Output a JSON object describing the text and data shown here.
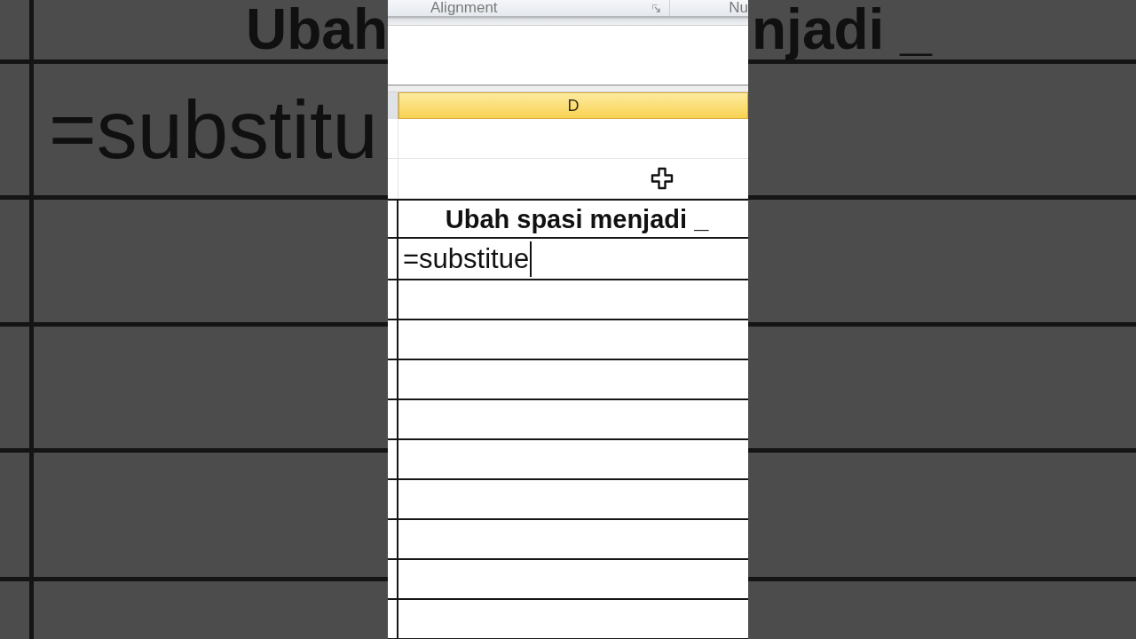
{
  "backdrop": {
    "left": [
      {
        "kind": "title",
        "text": "Ubah"
      },
      {
        "kind": "formula",
        "text": "=substitu"
      }
    ],
    "right": [
      {
        "kind": "title",
        "text": "njadi _"
      }
    ]
  },
  "ribbon": {
    "groups": [
      {
        "label": "Alignment",
        "launcher": true
      },
      {
        "label": "Nu",
        "launcher": false
      }
    ]
  },
  "sheet": {
    "columns": [
      {
        "label": "D",
        "selected": true
      }
    ],
    "rows": [
      {
        "kind": "blank",
        "pointer": false
      },
      {
        "kind": "blank",
        "pointer": true
      },
      {
        "kind": "title",
        "text": "Ubah spasi menjadi _",
        "pointer": false
      },
      {
        "kind": "editing",
        "value": "=substitue",
        "pointer": false
      },
      {
        "kind": "boxed",
        "pointer": false
      },
      {
        "kind": "boxed",
        "pointer": false
      },
      {
        "kind": "boxed",
        "pointer": false
      },
      {
        "kind": "boxed",
        "pointer": false
      },
      {
        "kind": "boxed",
        "pointer": false
      },
      {
        "kind": "boxed",
        "pointer": false
      },
      {
        "kind": "boxed",
        "pointer": false
      },
      {
        "kind": "boxed",
        "pointer": false
      },
      {
        "kind": "boxed",
        "pointer": false
      }
    ]
  }
}
